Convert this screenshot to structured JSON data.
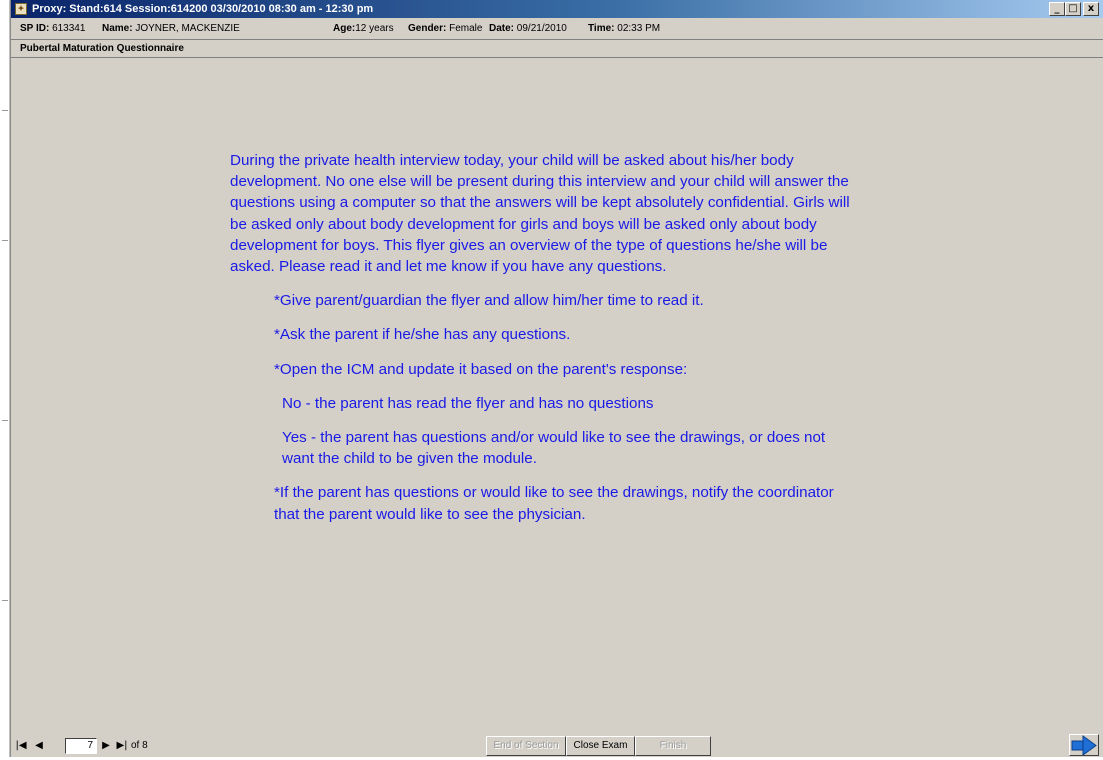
{
  "window": {
    "title": "Proxy: Stand:614 Session:614200 03/30/2010 08:30 am - 12:30 pm",
    "controls": {
      "minimize": "_",
      "maximize": "□",
      "close": "x"
    }
  },
  "info": {
    "sp_id_label": "SP ID:",
    "sp_id": "613341",
    "name_label": "Name:",
    "name": "JOYNER, MACKENZIE",
    "age_label": "Age:",
    "age": "12 years",
    "gender_label": "Gender:",
    "gender": "Female",
    "date_label": "Date:",
    "date": "09/21/2010",
    "time_label": "Time:",
    "time": "02:33 PM"
  },
  "section": {
    "title": "Pubertal Maturation Questionnaire"
  },
  "content": {
    "intro": "During the private health interview today, your child will be asked about his/her body development.  No one else will be present during this interview and your child will answer the questions using a computer so that the answers will be kept absolutely confidential.  Girls will be asked only about body development for girls and boys will be asked only about body development for boys.  This flyer gives an overview of the type of questions he/she will be asked.  Please read it and let me know if you have any questions.",
    "instruction1": "*Give parent/guardian the flyer and allow him/her time to read it.",
    "instruction2": "*Ask the parent if he/she has any questions.",
    "instruction3": "*Open the ICM and update it based on the parent's response:",
    "option_no": "No - the parent has read the flyer and has no questions",
    "option_yes": "Yes - the parent has questions and/or would like to see the drawings, or does not want the child to be given the module.",
    "instruction4": "*If the parent has questions or would like to see the drawings, notify the coordinator that the parent would like to see the physician."
  },
  "nav": {
    "current_page": "7",
    "of_label": "of 8",
    "first_icon": "|◀",
    "prev_icon": "◀",
    "next_icon": "▶",
    "last_icon": "▶|"
  },
  "buttons": {
    "end_of_section": "End of Section",
    "close_exam": "Close Exam",
    "finish": "Finish"
  },
  "colors": {
    "content_text": "#1a1ae6",
    "window_bg": "#d4d0c8",
    "title_gradient_start": "#0a246a",
    "next_arrow": "#1f6fd6"
  }
}
